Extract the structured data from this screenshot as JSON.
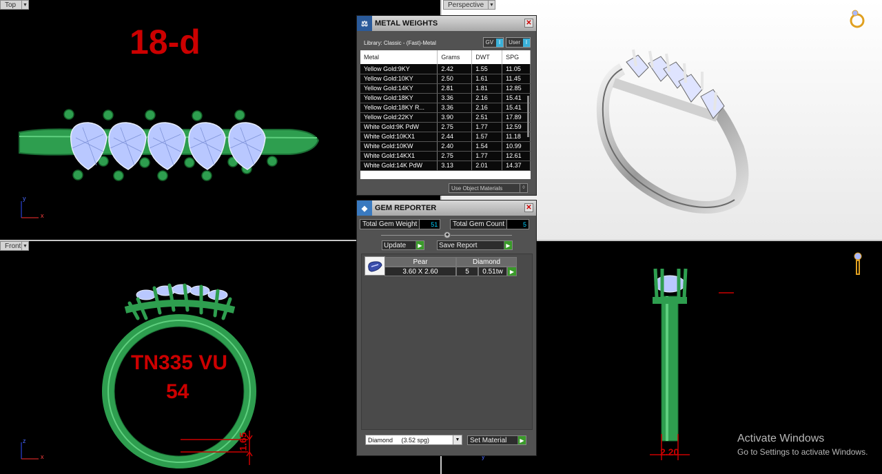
{
  "viewports": {
    "top": {
      "label": "Top",
      "annotation": "18-d"
    },
    "perspective": {
      "label": "Perspective"
    },
    "front": {
      "label": "Front",
      "annotation_line1": "TN335 VU",
      "annotation_line2": "54",
      "dimension": "1.65"
    },
    "right": {
      "dimension": "2.20"
    }
  },
  "axes": {
    "x": "x",
    "y": "y",
    "z": "z"
  },
  "metal_weights": {
    "title": "METAL WEIGHTS",
    "library": "Library: Classic - (Fast)-Metal",
    "gv_label": "GV",
    "user_label": "User",
    "toggle_glyph": "I",
    "columns": [
      "Metal",
      "Grams",
      "DWT",
      "SPG"
    ],
    "rows": [
      [
        "Yellow Gold:9KY",
        "2.42",
        "1.55",
        "11.05"
      ],
      [
        "Yellow Gold:10KY",
        "2.50",
        "1.61",
        "11.45"
      ],
      [
        "Yellow Gold:14KY",
        "2.81",
        "1.81",
        "12.85"
      ],
      [
        "Yellow Gold:18KY",
        "3.36",
        "2.16",
        "15.41"
      ],
      [
        "Yellow Gold:18KY R...",
        "3.36",
        "2.16",
        "15.41"
      ],
      [
        "Yellow Gold:22KY",
        "3.90",
        "2.51",
        "17.89"
      ],
      [
        "White Gold:9K PdW",
        "2.75",
        "1.77",
        "12.59"
      ],
      [
        "White Gold:10KX1",
        "2.44",
        "1.57",
        "11.18"
      ],
      [
        "White Gold:10KW",
        "2.40",
        "1.54",
        "10.99"
      ],
      [
        "White Gold:14KX1",
        "2.75",
        "1.77",
        "12.61"
      ],
      [
        "White Gold:14K PdW",
        "3.13",
        "2.01",
        "14.37"
      ]
    ],
    "use_object_materials": "Use Object Materials"
  },
  "gem_reporter": {
    "title": "GEM REPORTER",
    "total_weight_label": "Total Gem Weight",
    "total_weight_value": "51",
    "total_count_label": "Total Gem Count",
    "total_count_value": "5",
    "update_label": "Update",
    "save_report_label": "Save Report",
    "gem": {
      "shape": "Pear",
      "size": "3.60 X 2.60",
      "material": "Diamond",
      "count": "5",
      "weight": "0.51tw"
    },
    "material_select": "Diamond     (3.52 spg)",
    "set_material_label": "Set Material"
  },
  "activation": {
    "line1": "Activate Windows",
    "line2": "Go to Settings to activate Windows."
  },
  "colors": {
    "ring_green": "#2e9e4f",
    "gem_blue": "#b9c8ff",
    "annotation_red": "#cc0000",
    "value_cyan": "#00d0ff"
  }
}
